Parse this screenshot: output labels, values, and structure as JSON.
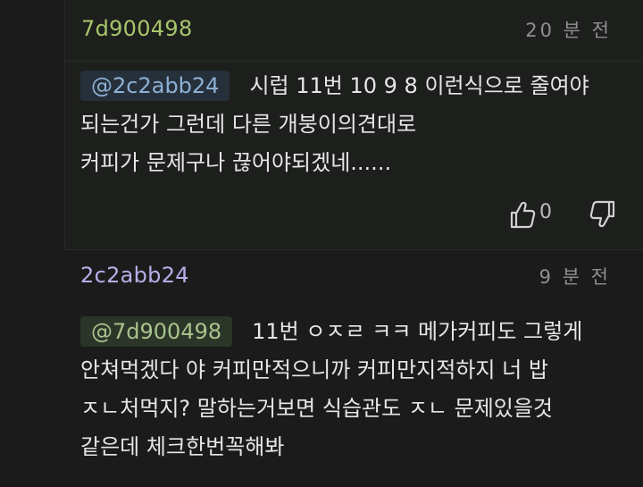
{
  "comments": [
    {
      "author": "7d900498",
      "time": "20 분 전",
      "mention": "@2c2abb24",
      "lines": [
        "시럽 11번 10 9 8 이런식으로 줄여야",
        "되는건가 그런데 다른 개붕이의견대로",
        "커피가 문제구나 끊어야되겠네......"
      ],
      "likes": "0",
      "icons": {
        "like": "thumbs-up-icon",
        "dislike": "thumbs-down-icon"
      }
    },
    {
      "author": "2c2abb24",
      "time": "9 분 전",
      "mention": "@7d900498",
      "lines": [
        "11번 ㅇㅈㄹ ㅋㅋ 메가커피도 그렇게",
        "안쳐먹겠다 야 커피만적으니까 커피만지적하지 너 밥",
        "ㅈㄴ처먹지? 말하는거보면 식습관도 ㅈㄴ 문제있을것",
        "같은데 체크한번꼭해봐"
      ]
    }
  ],
  "colors": {
    "background": "#1b1b1b",
    "author1": "#a7c56a",
    "author2": "#b9aee8",
    "mention": "#8db0d4"
  }
}
